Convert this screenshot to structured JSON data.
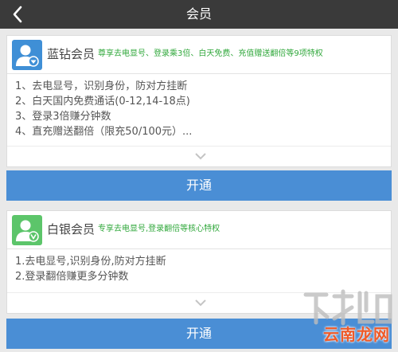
{
  "header": {
    "title": "会员"
  },
  "tiers": [
    {
      "name": "蓝钻会员",
      "desc": "尊享去电显号、登录乘3倍、白天免费、充值赠送翻倍等9项特权",
      "benefits": [
        "1、去电显号，识别身份，防对方挂断",
        "2、白天国内免费通话(0-12,14-18点)",
        "3、登录3倍赚分钟数",
        "4、直充赠送翻倍（限充50/100元）..."
      ],
      "button": "开通",
      "color": "#3f8fd6"
    },
    {
      "name": "白银会员",
      "desc": "专享去电显号,登录翻倍等核心特权",
      "benefits": [
        "1.去电显号,识别身份,防对方挂断",
        "2.登录翻倍赚更多分钟数"
      ],
      "button": "开通",
      "color": "#5cc56a"
    }
  ],
  "watermark": {
    "text": "云南龙网"
  }
}
